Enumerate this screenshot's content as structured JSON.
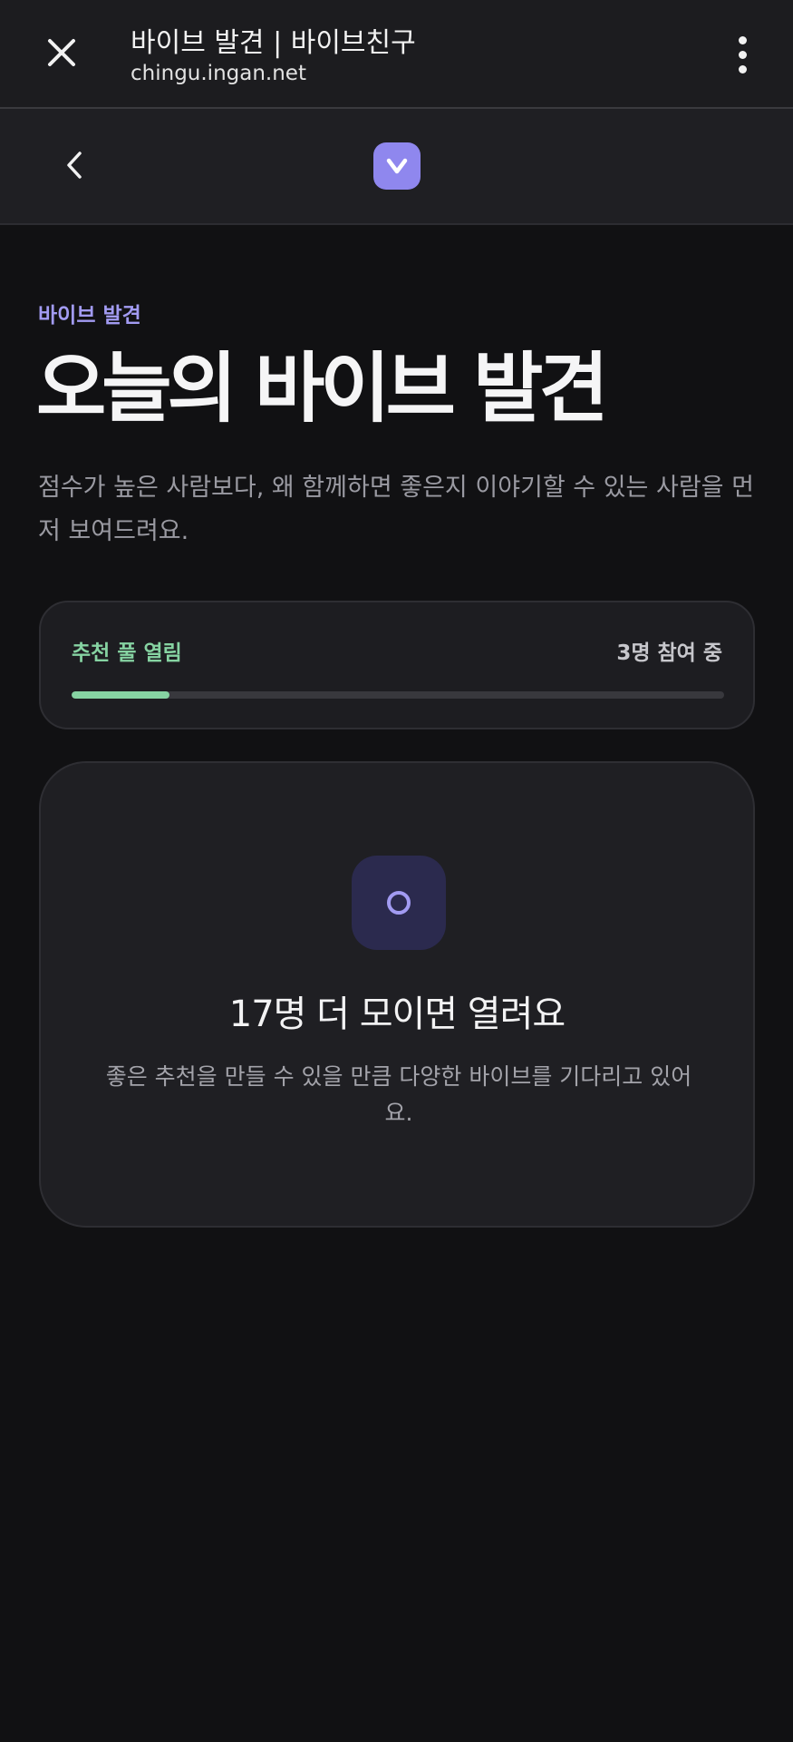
{
  "browser": {
    "title": "바이브 발견 | 바이브친구",
    "url": "chingu.ingan.net",
    "close_icon": "close-icon",
    "more_icon": "more-vert-icon"
  },
  "header": {
    "back_icon": "chevron-left-icon",
    "logo_letter": "V",
    "logo_color": "#8f87ee"
  },
  "main": {
    "eyebrow": "바이브 발견",
    "title": "오늘의 바이브 발견",
    "description": "점수가 높은 사람보다, 왜 함께하면 좋은지 이야기할 수 있는 사람을 먼저 보여드려요."
  },
  "pool": {
    "label": "추천 풀 열림",
    "count_text": "3명 참여 중",
    "progress_fraction": 0.15,
    "accent_color": "#86d3a2"
  },
  "waiting": {
    "icon": "circle-icon",
    "title": "17명 더 모이면 열려요",
    "description": "좋은 추천을 만들 수 있을 만큼 다양한 바이브를 기다리고 있어요."
  }
}
